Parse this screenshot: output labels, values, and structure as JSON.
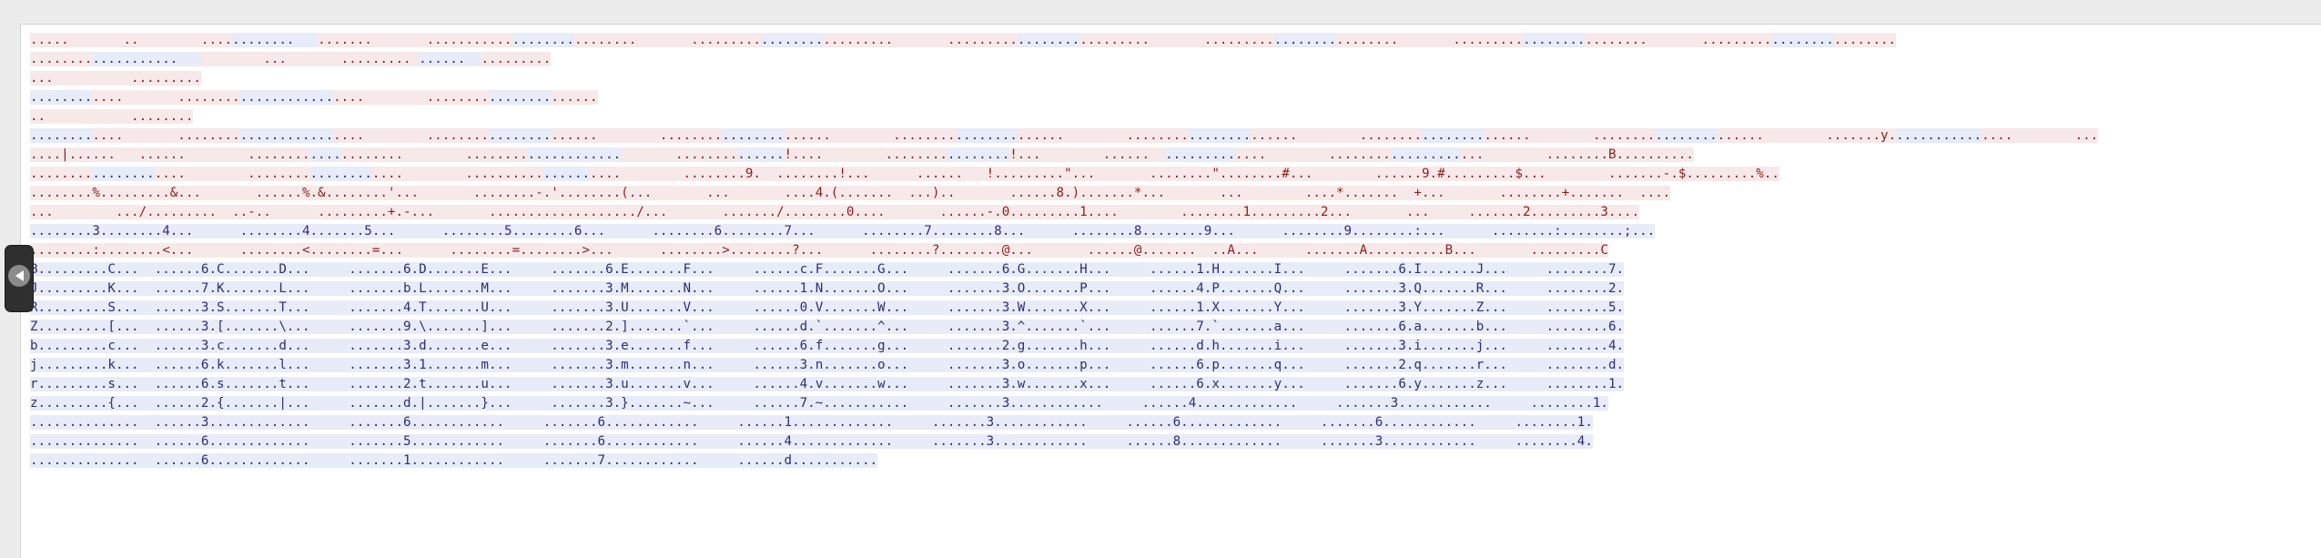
{
  "toggle_button": {
    "icon": "chevron-left-icon"
  },
  "colors": {
    "red_band": "#f7e9e9",
    "blue_band": "#e8ebf8",
    "red_text": "#8a1e1e",
    "blue_text": "#2b3070",
    "panel": "#ffffff",
    "background": "#ececec"
  },
  "lines": [
    [
      [
        "r",
        ".....       ..        ...."
      ],
      [
        "b",
        "........   "
      ],
      [
        "r",
        ".......       ..........."
      ],
      [
        "b",
        "........"
      ],
      [
        "r",
        "........       ........."
      ],
      [
        "b",
        "........"
      ],
      [
        "r",
        ".........       ........."
      ],
      [
        "b",
        "........"
      ],
      [
        "r",
        ".........       ........."
      ],
      [
        "b",
        "........"
      ],
      [
        "r",
        "........       ........."
      ],
      [
        "b",
        "........"
      ],
      [
        "r",
        "........       ........."
      ],
      [
        "b",
        "........"
      ],
      [
        "r",
        "........"
      ]
    ],
    [
      [
        "r",
        "........"
      ],
      [
        "b",
        "...........   "
      ],
      [
        "r",
        "        ...       ......... "
      ],
      [
        "b",
        "......  "
      ],
      [
        "r",
        "........."
      ]
    ],
    [
      [
        "r",
        "...          ........."
      ]
    ],
    [
      [
        "b",
        "........"
      ],
      [
        "r",
        "....       ........"
      ],
      [
        "b",
        "............"
      ],
      [
        "r",
        "....        ........"
      ],
      [
        "b",
        "........"
      ],
      [
        "r",
        "......"
      ]
    ],
    [
      [
        "r",
        "..           ........"
      ]
    ],
    [
      [
        "b",
        "........"
      ],
      [
        "r",
        "....       ........"
      ],
      [
        "b",
        "............"
      ],
      [
        "r",
        "....        ........"
      ],
      [
        "b",
        "........"
      ],
      [
        "r",
        "......        ........"
      ],
      [
        "b",
        "........"
      ],
      [
        "r",
        "......        ........"
      ],
      [
        "b",
        "........"
      ],
      [
        "r",
        "......        ........"
      ],
      [
        "b",
        "........"
      ],
      [
        "r",
        "......        ........"
      ],
      [
        "b",
        "........"
      ],
      [
        "r",
        "......        ........"
      ],
      [
        "b",
        "........"
      ],
      [
        "r",
        "......        .......y."
      ],
      [
        "b",
        "..........."
      ],
      [
        "r",
        "....        ..."
      ]
    ],
    [
      [
        "r",
        "....|......   ......        ........"
      ],
      [
        "b",
        "...."
      ],
      [
        "r",
        "........        ........"
      ],
      [
        "b",
        "............"
      ],
      [
        "r",
        "       ........"
      ],
      [
        "b",
        "......"
      ],
      [
        "r",
        "!....        ........"
      ],
      [
        "b",
        "........"
      ],
      [
        "r",
        "!...        ......  "
      ],
      [
        "b",
        "........."
      ],
      [
        "r",
        "....        ........"
      ],
      [
        "b",
        "........."
      ],
      [
        "r",
        "...        ........B.........."
      ]
    ],
    [
      [
        "r",
        "........"
      ],
      [
        "b",
        "........"
      ],
      [
        "r",
        "....        ........"
      ],
      [
        "b",
        "........"
      ],
      [
        "r",
        "....        .........."
      ],
      [
        "b",
        "......"
      ],
      [
        "r",
        "....        ........9.  ........!...      ......   !.........\"...       ........\"........#...        ......9.#.........$...        .......-.$.........%.."
      ]
    ],
    [
      [
        "r",
        "........%.........&...       ......%.&........'...       ........-.'........(...       ...       ....4.(.......  ...)..       ......8.).......*...       ...        ....*.......  +...       ........+.......  ...."
      ]
    ],
    [
      [
        "r",
        "...        .../.........  ..-..      .........+.-...       .................../...       ......./........0....       ......-.0.........1....        ........1.........2...       ...     .......2.........3...."
      ]
    ],
    [
      [
        "b",
        "........3........4...      ........4.......5...      ........5........6...      ........6........7...      ........7........8...      ........8........9...      ........9........:...      ........:........;..."
      ]
    ],
    [
      [
        "r",
        "........:........<...      ........<........=...      ........=........>...      ........>........?...      ........?........@...       ......@.......  ..A...      .......A..........B...       .........C"
      ]
    ],
    [
      [
        "b",
        "B.........C...  ......6.C.......D...     .......6.D.......E...     .......6.E.......F...     ......c.F.......G...     .......6.G.......H...     ......1.H.......I...     .......6.I.......J...     ........7."
      ]
    ],
    [
      [
        "b",
        "J.........K...  ......7.K.......L...     .......b.L.......M...     .......3.M.......N...     ......1.N.......O...     .......3.O.......P...     ......4.P.......Q...     .......3.Q.......R...     ........2."
      ]
    ],
    [
      [
        "b",
        "R.........S...  ......3.S.......T...     .......4.T.......U...     .......3.U.......V...     ......0.V.......W...     .......3.W.......X...     ......1.X.......Y...     .......3.Y.......Z...     ........5."
      ]
    ],
    [
      [
        "b",
        "Z.........[...  ......3.[.......\\...     .......9.\\.......]...     .......2.].......`...     ......d.`.......^...     .......3.^.......`...     ......7.`.......a...     .......6.a.......b...     ........6."
      ]
    ],
    [
      [
        "b",
        "b.........c...  ......3.c.......d...     .......3.d.......e...     .......3.e.......f...     ......6.f.......g...     .......2.g.......h...     ......d.h.......i...     .......3.i.......j...     ........4."
      ]
    ],
    [
      [
        "b",
        "j.........k...  ......6.k.......l...     .......3.1.......m...     .......3.m.......n...     ......3.n.......o...     .......3.o.......p...     ......6.p.......q...     .......2.q.......r...     ........d."
      ]
    ],
    [
      [
        "b",
        "r.........s...  ......6.s.......t...     .......2.t.......u...     .......3.u.......v...     ......4.v.......w...     .......3.w.......x...     ......6.x.......y...     .......6.y.......z...     ........1."
      ]
    ],
    [
      [
        "b",
        "z.........{...  ......2.{.......|...     .......d.|.......}...     .......3.}.......~...     ......7.~...........     .......3............     ......4.............     .......3............     ........1."
      ]
    ],
    [
      [
        "b",
        "..............  ......3.............     .......6............     .......6............     ......1.............     .......3............     ......6.............     .......6............     ........1."
      ]
    ],
    [
      [
        "b",
        "..............  ......6.............     .......5............     .......6............     ......4.............     .......3............     ......8.............     .......3............     ........4."
      ]
    ],
    [
      [
        "b",
        "..............  ......6.............     .......1............     .......7............     ......d..........."
      ]
    ]
  ]
}
